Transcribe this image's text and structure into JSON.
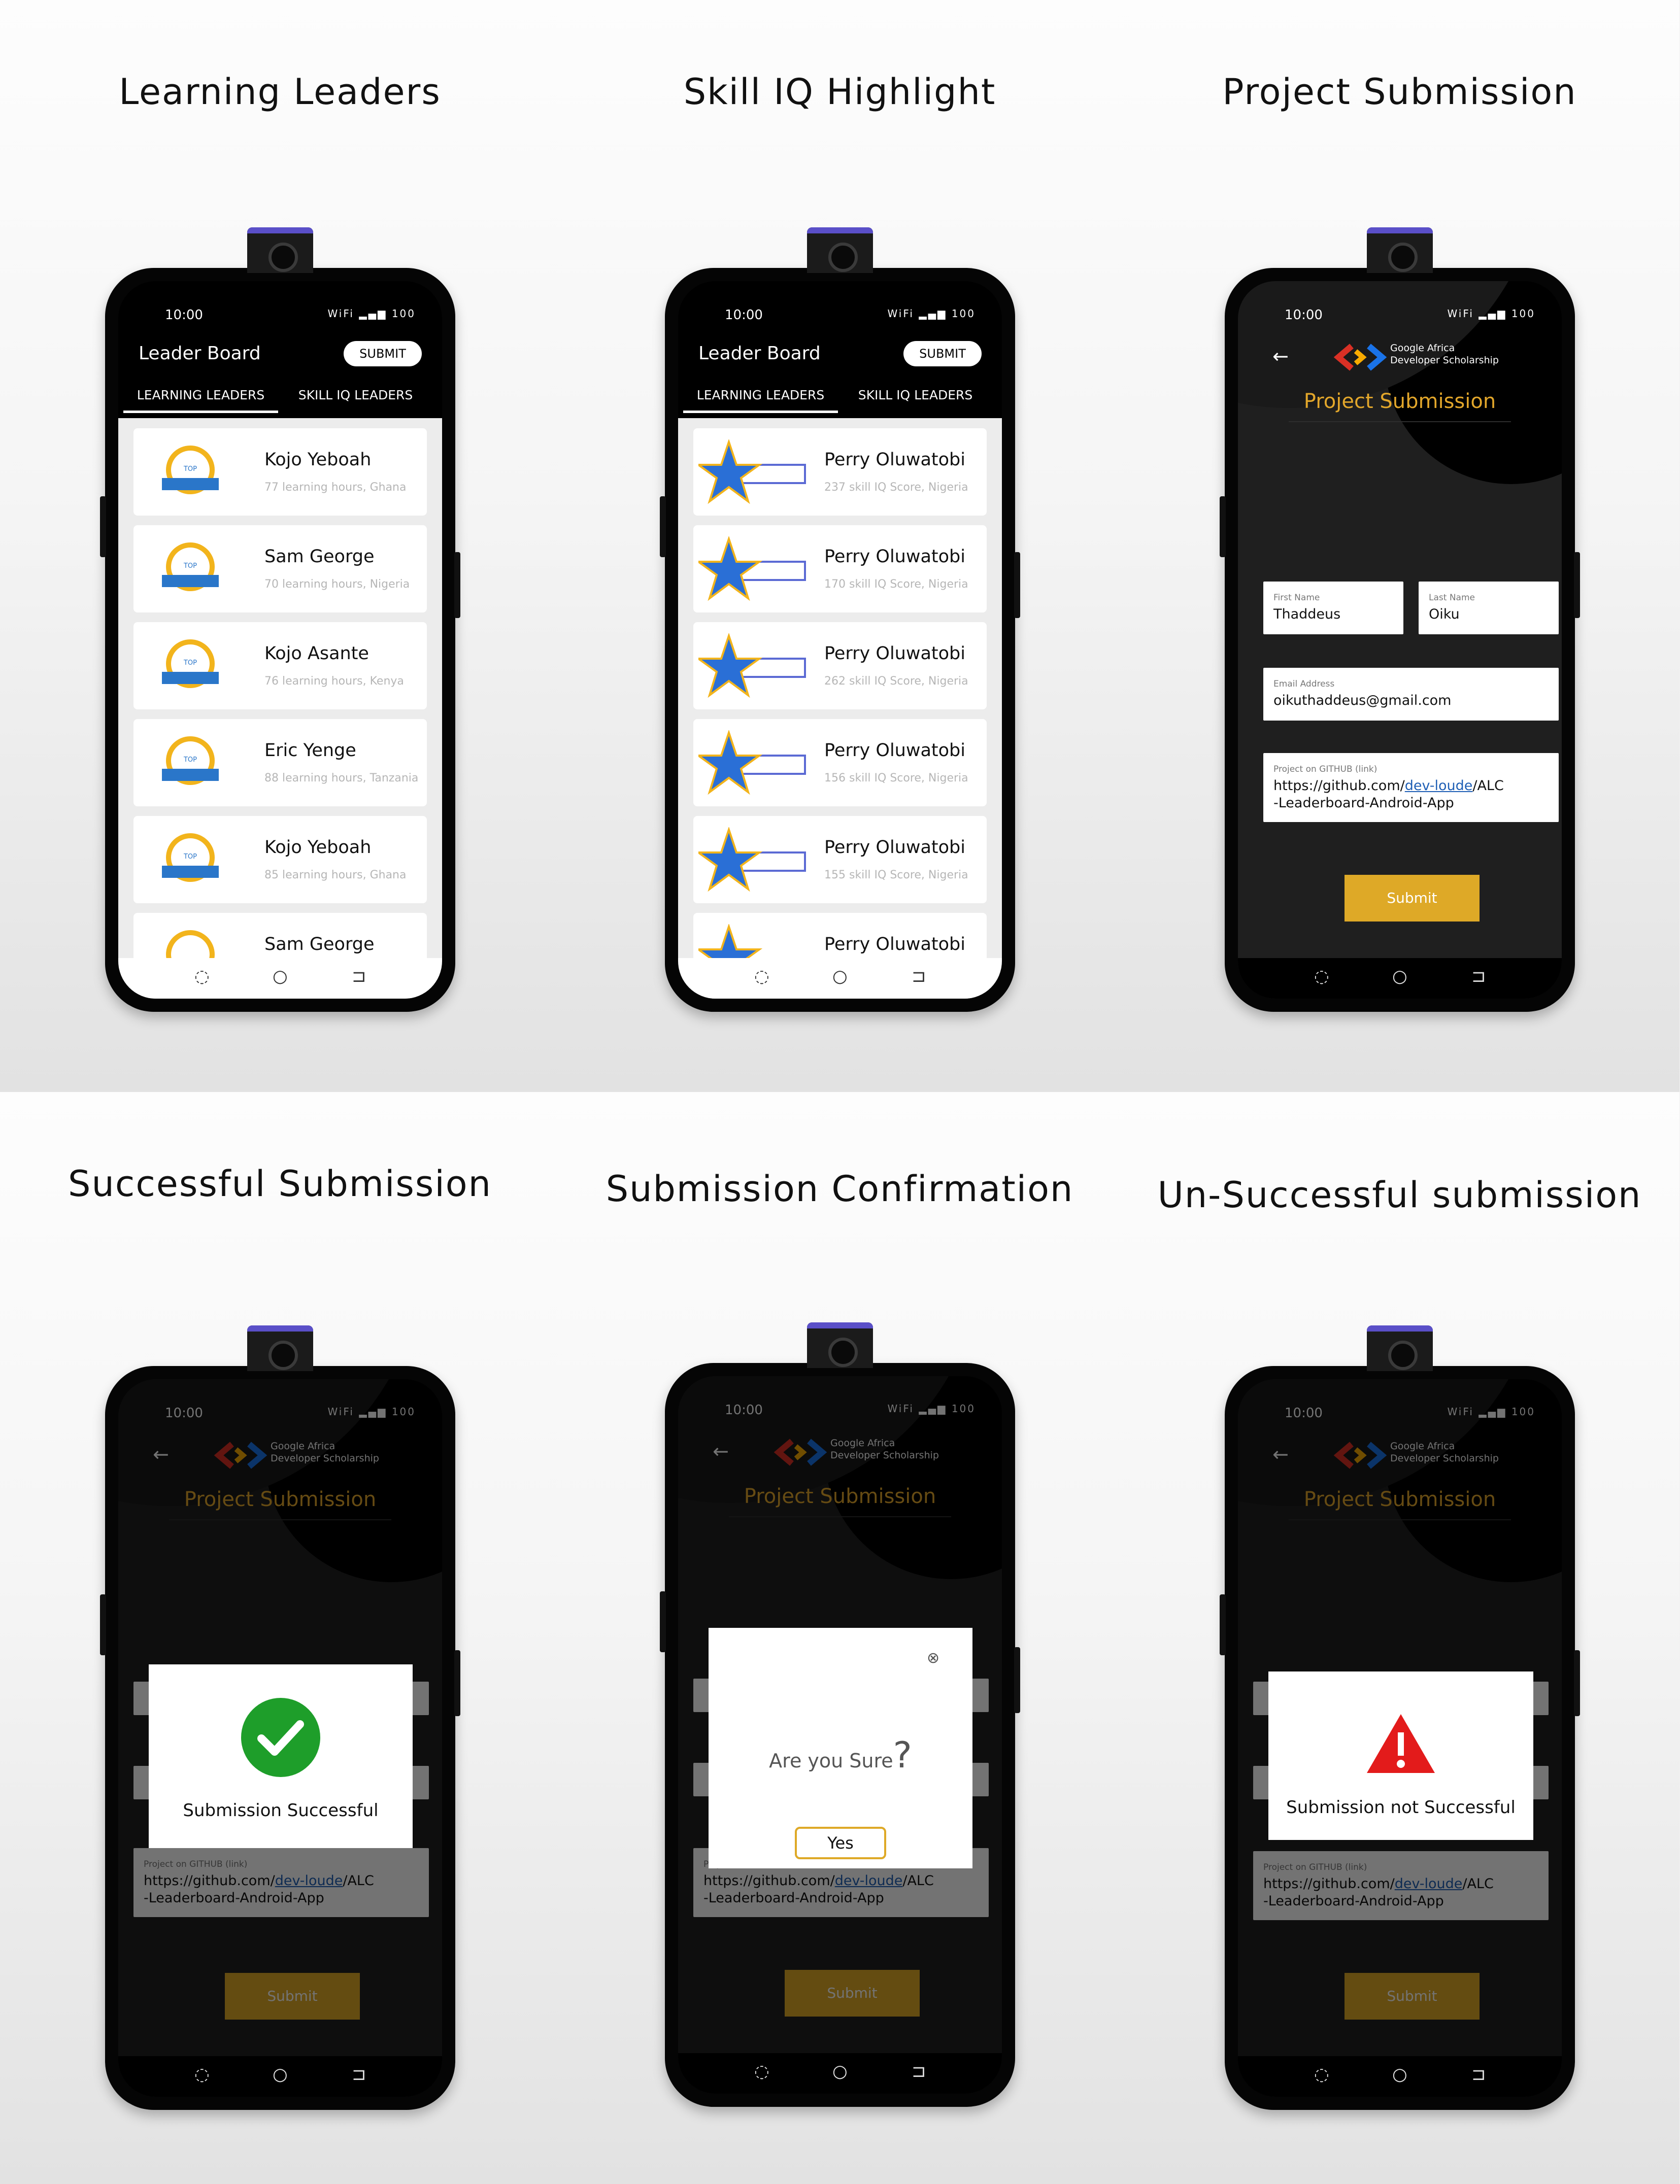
{
  "titles": [
    "Learning Leaders",
    "Skill IQ Highlight",
    "Project Submission",
    "Successful Submission",
    "Submission Confirmation",
    "Un-Successful submission"
  ],
  "status": {
    "time": "10:00",
    "icons": "WiFi ▂▄▆ 100"
  },
  "leaderboard": {
    "title": "Leader Board",
    "submit_label": "SUBMIT",
    "tabs": [
      "LEARNING LEADERS",
      "SKILL IQ LEADERS"
    ],
    "learning": [
      {
        "name": "Kojo Yeboah",
        "detail": "77 learning hours, Ghana"
      },
      {
        "name": "Sam George",
        "detail": "70 learning hours, Nigeria"
      },
      {
        "name": "Kojo Asante",
        "detail": "76 learning hours, Kenya"
      },
      {
        "name": "Eric Yenge",
        "detail": "88 learning hours, Tanzania"
      },
      {
        "name": "Kojo Yeboah",
        "detail": "85 learning hours, Ghana"
      },
      {
        "name": "Sam George",
        "detail": ""
      }
    ],
    "skill": [
      {
        "name": "Perry Oluwatobi",
        "detail": "237 skill IQ Score, Nigeria"
      },
      {
        "name": "Perry Oluwatobi",
        "detail": "170 skill IQ Score, Nigeria"
      },
      {
        "name": "Perry Oluwatobi",
        "detail": "262 skill IQ Score, Nigeria"
      },
      {
        "name": "Perry Oluwatobi",
        "detail": "156 skill IQ Score, Nigeria"
      },
      {
        "name": "Perry Oluwatobi",
        "detail": "155 skill IQ Score, Nigeria"
      },
      {
        "name": "Perry Oluwatobi",
        "detail": ""
      }
    ],
    "badge_text": "TOP LEARNER"
  },
  "submission": {
    "brand_line1": "Google Africa",
    "brand_line2": "Developer Scholarship",
    "title": "Project Submission",
    "first_name_label": "First Name",
    "first_name": "Thaddeus",
    "last_name_label": "Last Name",
    "last_name": "Oiku",
    "email_label": "Email Address",
    "email": "oikuthaddeus@gmail.com",
    "project_label": "Project on GITHUB (link)",
    "project_prefix": "https://github.com/",
    "project_user": "dev-loude",
    "project_suffix": "/ALC",
    "project_line2": "-Leaderboard-Android-App",
    "submit_label": "Submit"
  },
  "dialogs": {
    "success": "Submission Successful",
    "confirm": "Are you Sure",
    "confirm_mark": "?",
    "yes": "Yes",
    "fail": "Submission not Successful"
  },
  "colors": {
    "accent": "#dea927",
    "success": "#1e9e2a",
    "error": "#e31b1b",
    "link": "#1f5fb5"
  }
}
